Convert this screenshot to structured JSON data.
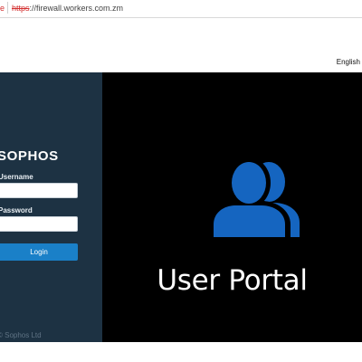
{
  "browser": {
    "leading_fragment": "e",
    "url_scheme": "https",
    "url_rest": "://firewall.workers.com.zm"
  },
  "language": {
    "selected": "English"
  },
  "login": {
    "brand": "SOPHOS",
    "username_label": "Username",
    "password_label": "Password",
    "username_value": "",
    "password_value": "",
    "login_button": "Login",
    "copyright": "© Sophos Ltd"
  },
  "banner": {
    "title": "User Portal",
    "icon": "users-icon"
  },
  "colors": {
    "panel": "#1d3243",
    "accent": "#1a80c8",
    "icon": "#1565c0",
    "banner_bg": "#000000"
  }
}
